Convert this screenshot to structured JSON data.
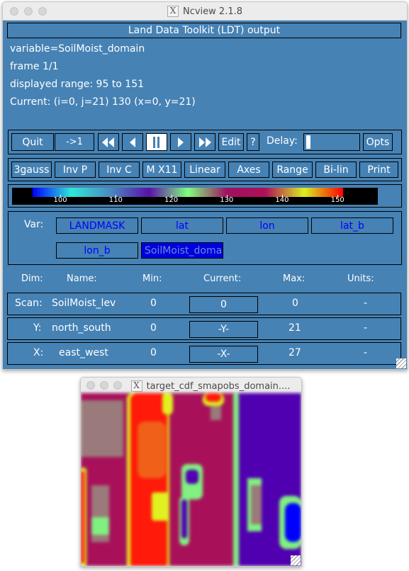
{
  "main_window": {
    "title": "Ncview 2.1.8",
    "header_title": "Land Data Toolkit (LDT) output",
    "info": {
      "variable": "variable=SoilMoist_domain",
      "frame": "frame 1/1",
      "range": "displayed range: 95 to 151",
      "current": "Current: (i=0, j=21) 130 (x=0, y=21)"
    },
    "toolbar1": {
      "quit": "Quit",
      "to_first": "->1",
      "fast_back_icon": "fast-rewind-icon",
      "step_back_icon": "step-back-icon",
      "pause_icon": "pause-icon",
      "step_fwd_icon": "step-forward-icon",
      "fast_fwd_icon": "fast-forward-icon",
      "edit": "Edit",
      "help": "?",
      "delay_label": "Delay:",
      "delay_value": 0,
      "opts": "Opts"
    },
    "toolbar2": [
      "3gauss",
      "Inv P",
      "Inv C",
      "M X11",
      "Linear",
      "Axes",
      "Range",
      "Bi-lin",
      "Print"
    ],
    "colorbar": {
      "min": 95,
      "max": 151,
      "tick_labels": [
        "100",
        "110",
        "120",
        "130",
        "140",
        "150"
      ],
      "stops": [
        "#0000ff",
        "#2fe8d8",
        "#4a8ac0",
        "#5a10a8",
        "#80ff80",
        "#a01060",
        "#b0105a",
        "#d8f020",
        "#ff0000"
      ]
    },
    "var_panel": {
      "label": "Var:",
      "vars": [
        "LANDMASK",
        "lat",
        "lon",
        "lat_b",
        "lon_b",
        "SoilMoist_doma"
      ],
      "selected": "SoilMoist_doma"
    },
    "dims": {
      "headers": [
        "Dim:",
        "Name:",
        "Min:",
        "Current:",
        "Max:",
        "Units:"
      ],
      "rows": [
        {
          "dim": "Scan:",
          "name": "SoilMoist_lev",
          "min": "0",
          "current": "0",
          "max": "0",
          "units": "-"
        },
        {
          "dim": "Y:",
          "name": "north_south",
          "min": "0",
          "current": "-Y-",
          "max": "21",
          "units": "-"
        },
        {
          "dim": "X:",
          "name": "east_west",
          "min": "0",
          "current": "-X-",
          "max": "27",
          "units": "-"
        }
      ]
    }
  },
  "image_window": {
    "title": "target_cdf_smapobs_domain....",
    "colors": {
      "background": "#a8115a",
      "red": "#ff1a0a",
      "orange": "#f06018",
      "yellow": "#e0f020",
      "green": "#80f080",
      "purple": "#5000b0",
      "blue": "#0000ff",
      "gray": "#9a7a7a"
    }
  }
}
